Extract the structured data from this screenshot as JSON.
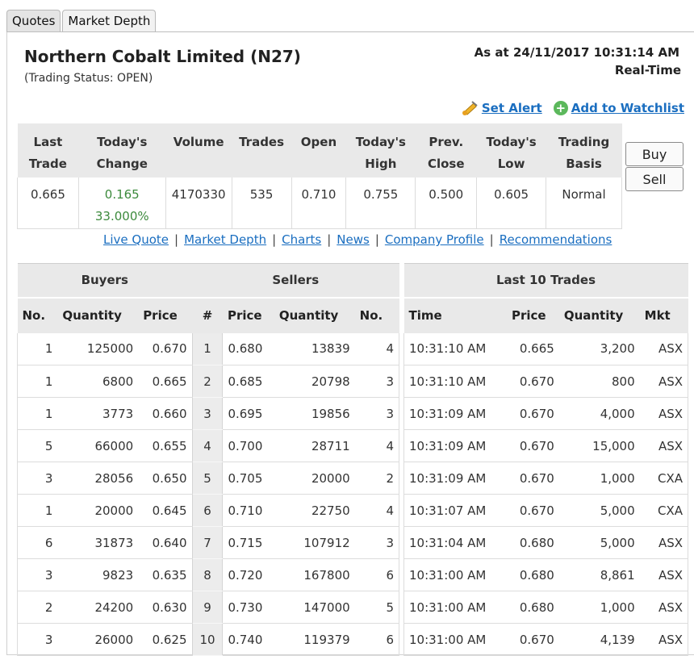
{
  "tabs": [
    "Quotes",
    "Market Depth"
  ],
  "company": {
    "name": "Northern Cobalt Limited (N27)",
    "trading_status": "(Trading Status: OPEN)",
    "as_at": "As at 24/11/2017 10:31:14 AM",
    "realtime": "Real-Time"
  },
  "actions": {
    "set_alert": "Set Alert",
    "add_watchlist": "Add to Watchlist"
  },
  "summary": {
    "headers": [
      [
        "Last",
        "Trade"
      ],
      [
        "Today's",
        "Change"
      ],
      [
        "Volume",
        ""
      ],
      [
        "Trades",
        ""
      ],
      [
        "Open",
        ""
      ],
      [
        "Today's",
        "High"
      ],
      [
        "Prev.",
        "Close"
      ],
      [
        "Today's",
        "Low"
      ],
      [
        "Trading",
        "Basis"
      ]
    ],
    "last_trade": "0.665",
    "change": "0.165",
    "change_pct": "33.000%",
    "volume": "4170330",
    "trades": "535",
    "open": "0.710",
    "high": "0.755",
    "prev_close": "0.500",
    "low": "0.605",
    "basis": "Normal"
  },
  "buttons": {
    "buy": "Buy",
    "sell": "Sell"
  },
  "links": [
    "Live Quote",
    "Market Depth",
    "Charts",
    "News",
    "Company Profile",
    "Recommendations"
  ],
  "depth": {
    "buyers_title": "Buyers",
    "sellers_title": "Sellers",
    "columns": [
      "No.",
      "Quantity",
      "Price",
      "#",
      "Price",
      "Quantity",
      "No."
    ],
    "rows": [
      [
        "1",
        "125000",
        "0.670",
        "1",
        "0.680",
        "13839",
        "4"
      ],
      [
        "1",
        "6800",
        "0.665",
        "2",
        "0.685",
        "20798",
        "3"
      ],
      [
        "1",
        "3773",
        "0.660",
        "3",
        "0.695",
        "19856",
        "3"
      ],
      [
        "5",
        "66000",
        "0.655",
        "4",
        "0.700",
        "28711",
        "4"
      ],
      [
        "3",
        "28056",
        "0.650",
        "5",
        "0.705",
        "20000",
        "2"
      ],
      [
        "1",
        "20000",
        "0.645",
        "6",
        "0.710",
        "22750",
        "4"
      ],
      [
        "6",
        "31873",
        "0.640",
        "7",
        "0.715",
        "107912",
        "3"
      ],
      [
        "3",
        "9823",
        "0.635",
        "8",
        "0.720",
        "167800",
        "6"
      ],
      [
        "2",
        "24200",
        "0.630",
        "9",
        "0.730",
        "147000",
        "5"
      ],
      [
        "3",
        "26000",
        "0.625",
        "10",
        "0.740",
        "119379",
        "6"
      ]
    ]
  },
  "trades": {
    "title": "Last 10 Trades",
    "columns": [
      "Time",
      "Price",
      "Quantity",
      "Mkt"
    ],
    "rows": [
      [
        "10:31:10 AM",
        "0.665",
        "3,200",
        "ASX"
      ],
      [
        "10:31:10 AM",
        "0.670",
        "800",
        "ASX"
      ],
      [
        "10:31:09 AM",
        "0.670",
        "4,000",
        "ASX"
      ],
      [
        "10:31:09 AM",
        "0.670",
        "15,000",
        "ASX"
      ],
      [
        "10:31:09 AM",
        "0.670",
        "1,000",
        "CXA"
      ],
      [
        "10:31:07 AM",
        "0.670",
        "5,000",
        "CXA"
      ],
      [
        "10:31:04 AM",
        "0.680",
        "5,000",
        "ASX"
      ],
      [
        "10:31:00 AM",
        "0.680",
        "8,861",
        "ASX"
      ],
      [
        "10:31:00 AM",
        "0.680",
        "1,000",
        "ASX"
      ],
      [
        "10:31:00 AM",
        "0.670",
        "4,139",
        "ASX"
      ]
    ]
  },
  "colors": {
    "link": "#1a6ec0",
    "positive": "#3c8a3c",
    "header_bg": "#e9e9e9"
  },
  "icons": {
    "alert": "alert-bell-icon",
    "watchlist": "plus-circle-icon"
  }
}
